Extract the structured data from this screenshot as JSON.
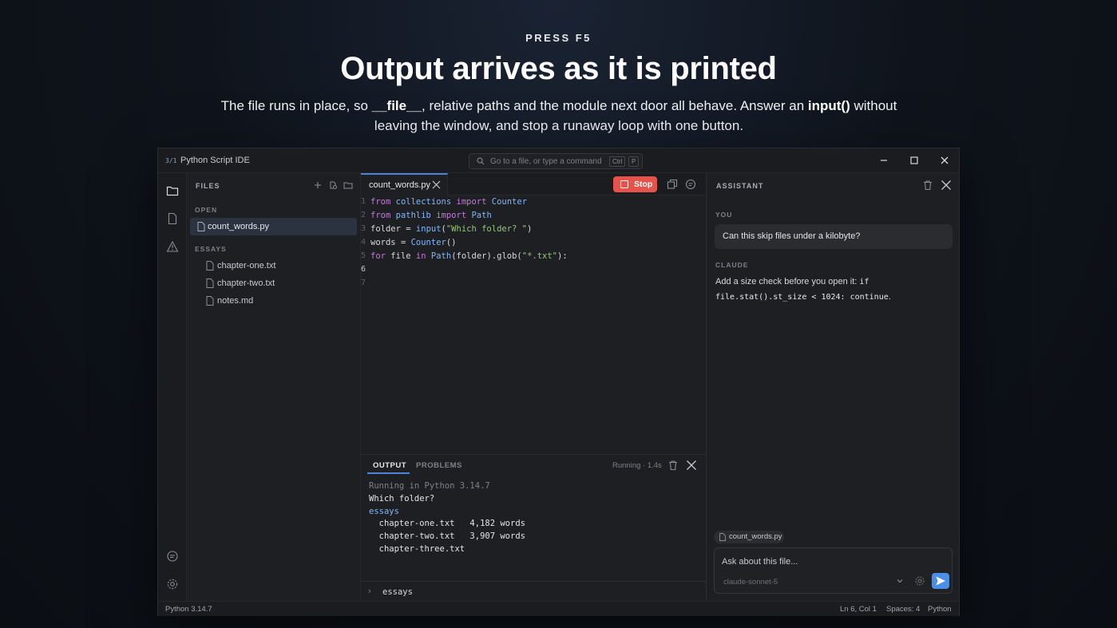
{
  "hero": {
    "eyebrow": "PRESS F5",
    "headline": "Output arrives as it is printed",
    "lede_1": "The file runs in place, so ",
    "lede_file": "__file__",
    "lede_2": ", relative paths and the module next door all behave. Answer an ",
    "lede_input": "input()",
    "lede_3": " without leaving the window, and stop a runaway loop with one button."
  },
  "window": {
    "logo": "3/1",
    "title": "Python Script IDE",
    "command_placeholder": "Go to a file, or type a command",
    "shortcut_mod": "Ctrl",
    "shortcut_key": "P"
  },
  "rail": {
    "icons": [
      "folder-icon",
      "file-icon",
      "warning-icon",
      "chat-icon",
      "gear-icon"
    ]
  },
  "explorer": {
    "heading": "FILES",
    "open_section": "OPEN",
    "open_files": [
      "count_words.py"
    ],
    "folder_section": "ESSAYS",
    "folder_files": [
      "chapter-one.txt",
      "chapter-two.txt",
      "notes.md"
    ]
  },
  "editor": {
    "tab_label": "count_words.py",
    "stop_label": "Stop",
    "line_numbers": [
      "1",
      "2",
      "3",
      "4",
      "5",
      "6",
      "7"
    ],
    "current_line": "6",
    "code_lines": [
      "from collections import Counter",
      "from pathlib import Path",
      "folder = input(\"Which folder? \")",
      "words = Counter()",
      "for file in Path(folder).glob(\"*.txt\"):",
      "",
      ""
    ]
  },
  "panel": {
    "tab_output": "OUTPUT",
    "tab_problems": "PROBLEMS",
    "status": "Running · 1.4s",
    "lines": [
      "Running in Python 3.14.7",
      "Which folder?",
      "essays",
      "  chapter-one.txt   4,182 words",
      "  chapter-two.txt   3,907 words",
      "  chapter-three.txt"
    ],
    "stdin_value": "essays"
  },
  "assistant": {
    "heading": "ASSISTANT",
    "user_role": "YOU",
    "user_message": "Can this skip files under a kilobyte?",
    "bot_role": "CLAUDE",
    "reply_text": "Add a size check before you open it: ",
    "reply_code_1": "if",
    "reply_code_2": "file.stat().st_size < 1024: continue",
    "reply_end": ".",
    "attachment": "count_words.py",
    "composer_placeholder": "Ask about this file...",
    "model": "claude-sonnet-5"
  },
  "statusbar": {
    "runtime": "Python 3.14.7",
    "cursor": "Ln 6, Col 1",
    "indent": "Spaces: 4",
    "language": "Python"
  },
  "colors": {
    "accent": "#4b84d8",
    "stop": "#e5534b",
    "send": "#4b8fe8",
    "keyword": "#c678dd",
    "identifier": "#7fb7ff",
    "string": "#98c379"
  }
}
